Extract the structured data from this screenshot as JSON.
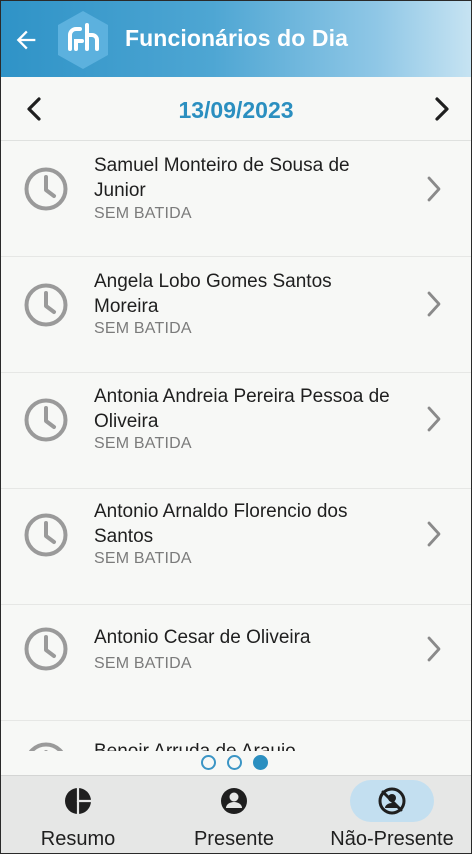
{
  "header": {
    "title": "Funcionários do Dia",
    "back_icon": "arrow-left-icon",
    "logo_icon": "company-logo-icon"
  },
  "datebar": {
    "date": "13/09/2023",
    "prev_icon": "chevron-left-icon",
    "next_icon": "chevron-right-icon"
  },
  "employees": [
    {
      "name": " Samuel Monteiro de Sousa de Junior",
      "status": "SEM BATIDA"
    },
    {
      "name": "Angela Lobo Gomes Santos Moreira",
      "status": "SEM BATIDA"
    },
    {
      "name": "Antonia Andreia Pereira Pessoa de Oliveira",
      "status": "SEM BATIDA"
    },
    {
      "name": "Antonio Arnaldo Florencio dos Santos",
      "status": "SEM BATIDA"
    },
    {
      "name": "Antonio Cesar de Oliveira",
      "status": "SEM BATIDA"
    },
    {
      "name": "Benoir Arruda de Araujo",
      "status": ""
    }
  ],
  "pager": {
    "pages": 3,
    "current": 3
  },
  "bottom_nav": {
    "tabs": [
      {
        "label": "Resumo",
        "icon": "pie-chart-icon",
        "active": false
      },
      {
        "label": "Presente",
        "icon": "person-icon",
        "active": false
      },
      {
        "label": "Não-Presente",
        "icon": "person-off-icon",
        "active": true
      }
    ]
  },
  "colors": {
    "primary": "#2b8fc0",
    "header_start": "#2f93c7",
    "header_end": "#c6e3f2",
    "active_tab": "#c3dff0"
  }
}
